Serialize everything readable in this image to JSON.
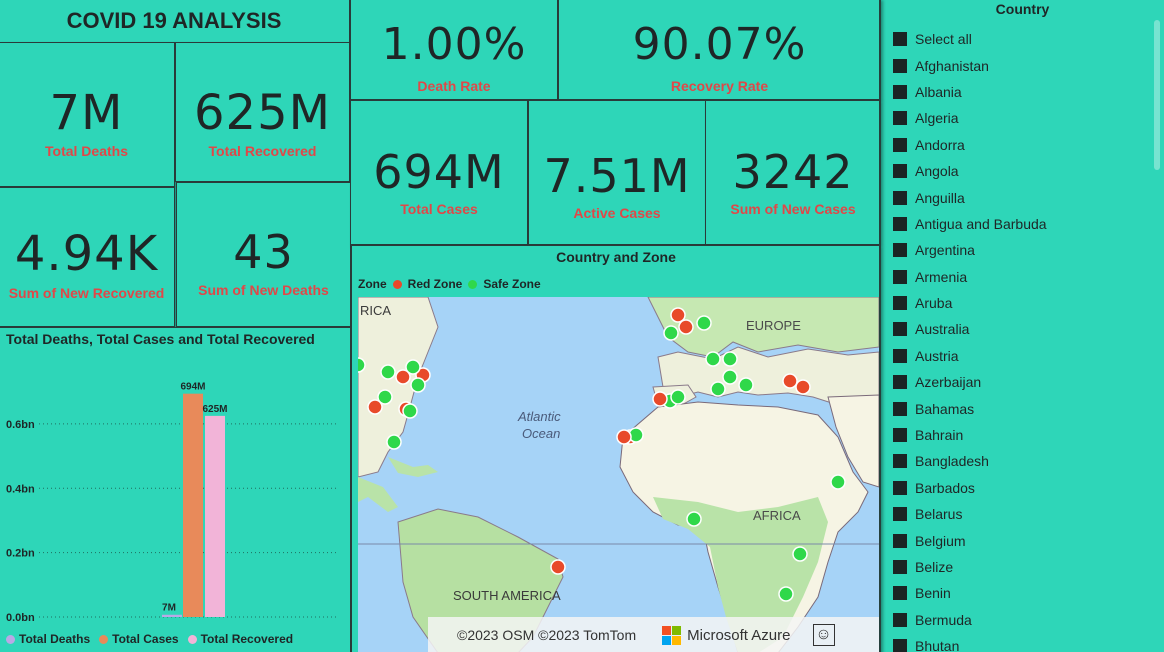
{
  "dashboard": {
    "title": "COVID 19 ANALYSIS"
  },
  "kpis": {
    "total_deaths": {
      "value": "7M",
      "label": "Total Deaths"
    },
    "total_recovered": {
      "value": "625M",
      "label": "Total Recovered"
    },
    "new_recovered": {
      "value": "4.94K",
      "label": "Sum of New Recovered"
    },
    "new_deaths": {
      "value": "43",
      "label": "Sum of New Deaths"
    },
    "death_rate": {
      "value": "1.00%",
      "label": "Death Rate"
    },
    "recovery_rate": {
      "value": "90.07%",
      "label": "Recovery Rate"
    },
    "total_cases": {
      "value": "694M",
      "label": "Total Cases"
    },
    "active_cases": {
      "value": "7.51M",
      "label": "Active Cases"
    },
    "new_cases": {
      "value": "3242",
      "label": "Sum of New Cases"
    }
  },
  "bar_chart": {
    "title": "Total Deaths, Total Cases and Total Recovered",
    "legend": [
      "Total Deaths",
      "Total Cases",
      "Total Recovered"
    ],
    "colors": {
      "deaths": "#b9a9e6",
      "cases": "#e88a5a",
      "recovered": "#f2b4d8"
    }
  },
  "chart_data": {
    "type": "bar",
    "title": "Total Deaths, Total Cases and Total Recovered",
    "categories": [
      ""
    ],
    "series": [
      {
        "name": "Total Deaths",
        "values": [
          7000000
        ],
        "data_label": "7M"
      },
      {
        "name": "Total Cases",
        "values": [
          694000000
        ],
        "data_label": "694M"
      },
      {
        "name": "Total Recovered",
        "values": [
          625000000
        ],
        "data_label": "625M"
      }
    ],
    "y_ticks": [
      "0.0bn",
      "0.2bn",
      "0.4bn",
      "0.6bn"
    ],
    "ylim": [
      0,
      0.78
    ],
    "y_unit": "bn",
    "legend_position": "bottom"
  },
  "map": {
    "title": "Country and Zone",
    "legend_title": "Zone",
    "legend_items": [
      {
        "label": "Red Zone",
        "color": "#e84a2a"
      },
      {
        "label": "Safe Zone",
        "color": "#2fd84a"
      }
    ],
    "labels": {
      "atlantic": "Atlantic",
      "ocean": "Ocean",
      "europe": "EUROPE",
      "africa": "AFRICA",
      "south_america": "SOUTH AMERICA",
      "rica": "RICA"
    },
    "attribution": "©2023 OSM ©2023 TomTom",
    "brand": "Microsoft Azure",
    "feedback_icon": "smiley-icon"
  },
  "slicer": {
    "header": "Country",
    "items": [
      "Select all",
      "Afghanistan",
      "Albania",
      "Algeria",
      "Andorra",
      "Angola",
      "Anguilla",
      "Antigua and Barbuda",
      "Argentina",
      "Armenia",
      "Aruba",
      "Australia",
      "Austria",
      "Azerbaijan",
      "Bahamas",
      "Bahrain",
      "Bangladesh",
      "Barbados",
      "Belarus",
      "Belgium",
      "Belize",
      "Benin",
      "Bermuda",
      "Bhutan"
    ]
  }
}
